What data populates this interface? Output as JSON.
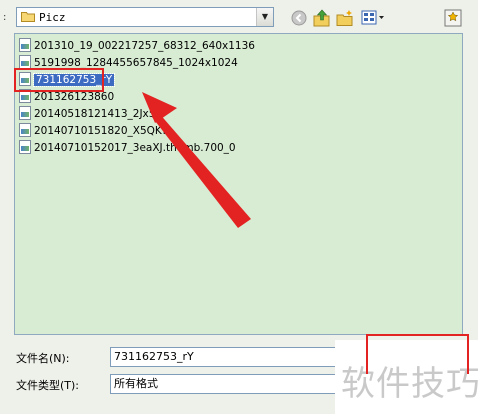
{
  "toolbar": {
    "left_marker": ":",
    "look_in": "Picz",
    "icons": [
      "back-icon",
      "up-folder-icon",
      "new-folder-icon",
      "view-menu-icon",
      "tools-icon"
    ]
  },
  "files": [
    {
      "name": "201310_19_002217257_68312_640x1136"
    },
    {
      "name": "5191998_1284455657845_1024x1024"
    },
    {
      "name": "731162753_rY"
    },
    {
      "name": "201326123860"
    },
    {
      "name": "20140518121413_2Jx5a"
    },
    {
      "name": "20140710151820_X5QKT"
    },
    {
      "name": "20140710152017_3eaXJ.thumb.700_0"
    }
  ],
  "form": {
    "filename_label": "文件名(N):",
    "filename_value": "731162753_rY",
    "filetype_label": "文件类型(T):",
    "filetype_value": "所有格式"
  },
  "watermark": "软件技巧",
  "colors": {
    "annotation": "#e32222",
    "list_bg": "#d8ecd3",
    "selection": "#3d6bc2"
  }
}
